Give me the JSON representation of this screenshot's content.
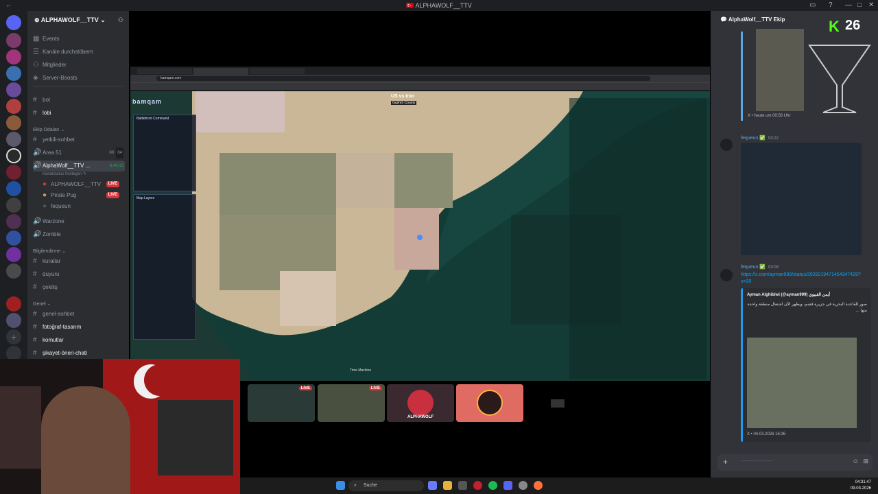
{
  "window": {
    "title": "ALPHAWOLF__TTV"
  },
  "server": {
    "name": "ALPHAWOLF__TTV"
  },
  "sidebar": {
    "nav": [
      "Events",
      "Kanäle durchstöbern",
      "Mitglieder",
      "Server-Boosts"
    ],
    "top_channels": [
      "bot",
      "lobi"
    ],
    "cat_ekip": "Ekip Odaları",
    "ekip_channels": [
      "yetkili-sohbet",
      "Area 51"
    ],
    "area51_count": "00",
    "area51_count2": "04",
    "active_voice": {
      "name": "AlphaWolf__TTV ...",
      "timer": "6:46:13",
      "status": "Kanalstatus festlegen"
    },
    "voice_members": [
      {
        "name": "ALPHAWOLF__TTV",
        "live": "LIVE"
      },
      {
        "name": "Pirate Pug",
        "live": "LIVE"
      },
      {
        "name": "fequeun",
        "live": ""
      }
    ],
    "more_voice": [
      "Warzone",
      "Zombie"
    ],
    "cat_bilgi": "Bilgilendirme",
    "bilgi_channels": [
      "kurallar",
      "duyuru",
      "çekiliş"
    ],
    "cat_genel": "Genel",
    "genel_channels": [
      "genel-sohbet",
      "fotoğraf-tasarım",
      "komutlar",
      "şikayet-öneri-chati"
    ]
  },
  "stream": {
    "url": "bamqam.com",
    "site_logo": "bamqam",
    "map_title": "US vs Iran",
    "map_sub": "Gashm County",
    "panel_title": "Battlefront Command",
    "layers_title": "Map Layers",
    "time_label": "Time Machine",
    "thumb_live": "LIVE",
    "thumb_logo": "ALPHAWOLF"
  },
  "chat": {
    "channel": "AlphaWolf__TTV Ekip",
    "msg1_time": "heute um 00:56 Uhr",
    "msg2_user": "fequeun",
    "msg2_time": "03:22",
    "msg3_user": "fequeun",
    "msg3_time": "03:09",
    "msg3_link": "https://x.com/ayman999/status/2029219471454347429?s=20",
    "embed_author": "Ayman Alghibiwi (@ayman999) أيمن القبيوي",
    "embed_text": "صور للقاعدة البحرية في جزيرة قشم، ويظهر الآن اشتعال منطقة واحدة منها ...",
    "embed_time": "04.03.2026 16:36",
    "input_placeholder": "--------------------",
    "overlay_count": "26",
    "overlay_k": "K"
  },
  "taskbar": {
    "search": "Suche",
    "time": "04:31:47",
    "date": "09.03.2026"
  },
  "colors": {
    "live": "#da373c",
    "accent": "#5aa9e6",
    "kick": "#53fc18"
  }
}
